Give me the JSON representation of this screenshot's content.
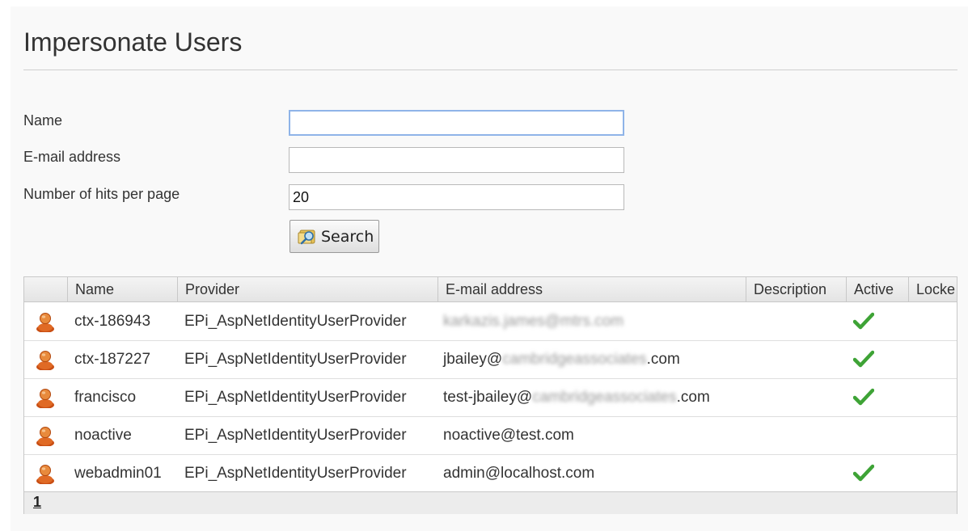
{
  "page": {
    "title": "Impersonate Users"
  },
  "form": {
    "name_label": "Name",
    "name_value": "",
    "email_label": "E-mail address",
    "email_value": "",
    "hits_label": "Number of hits per page",
    "hits_value": "20",
    "search_label": "Search"
  },
  "table": {
    "headers": {
      "name": "Name",
      "provider": "Provider",
      "email": "E-mail address",
      "description": "Description",
      "active": "Active",
      "locked": "Locke"
    },
    "rows": [
      {
        "name": "ctx-186943",
        "provider": "EPi_AspNetIdentityUserProvider",
        "email_pre": "",
        "email_blur": "karkazis.james@mtrs.com",
        "email_post": "",
        "active": true
      },
      {
        "name": "ctx-187227",
        "provider": "EPi_AspNetIdentityUserProvider",
        "email_pre": "jbailey@",
        "email_blur": "cambridgeassociates",
        "email_post": ".com",
        "active": true
      },
      {
        "name": "francisco",
        "provider": "EPi_AspNetIdentityUserProvider",
        "email_pre": "test-jbailey@",
        "email_blur": "cambridgeassociates",
        "email_post": ".com",
        "active": true
      },
      {
        "name": "noactive",
        "provider": "EPi_AspNetIdentityUserProvider",
        "email_pre": "noactive@test.com",
        "email_blur": "",
        "email_post": "",
        "active": false
      },
      {
        "name": "webadmin01",
        "provider": "EPi_AspNetIdentityUserProvider",
        "email_pre": "admin@localhost.com",
        "email_blur": "",
        "email_post": "",
        "active": true
      }
    ],
    "pager": {
      "current_page": "1"
    }
  },
  "icons": {
    "user_icon": "user-icon",
    "check_icon": "check-icon",
    "search_icon": "search-icon"
  },
  "colors": {
    "check_green": "#3ea336",
    "user_orange": "#d9631e",
    "focus_border": "#8fb4e8"
  }
}
